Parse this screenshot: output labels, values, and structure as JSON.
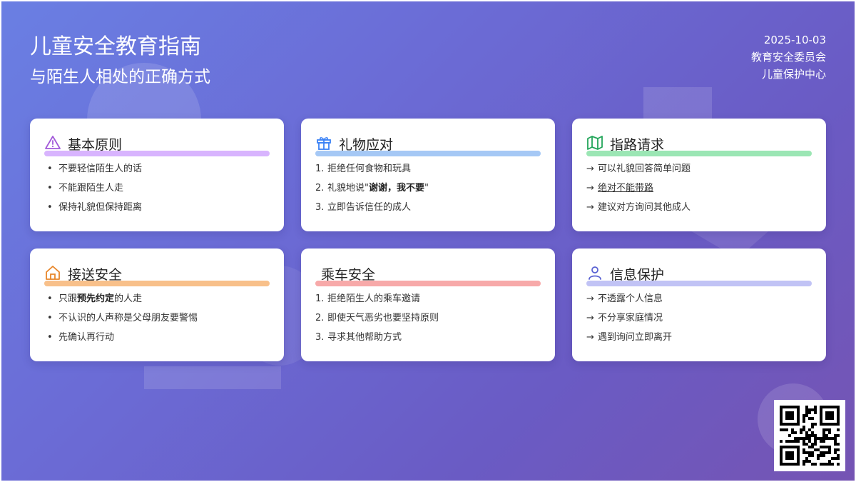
{
  "header": {
    "title": "儿童安全教育指南",
    "subtitle": "与陌生人相处的正确方式",
    "date": "2025-10-03",
    "org1": "教育安全委员会",
    "org2": "儿童保护中心"
  },
  "cards": [
    {
      "title": "基本原则",
      "icon": "warning-icon",
      "accent": "#d8b4fe",
      "items": [
        "不要轻信陌生人的话",
        "不能跟陌生人走",
        "保持礼貌但保持距离"
      ]
    },
    {
      "title": "礼物应对",
      "icon": "gift-icon",
      "accent": "#a5c8f5",
      "items": [
        "拒绝任何食物和玩具",
        "礼貌地说",
        "谢谢，我不要",
        "立即告诉信任的成人"
      ]
    },
    {
      "title": "指路请求",
      "icon": "map-icon",
      "accent": "#9be6b4",
      "items": [
        "可以礼貌回答简单问题",
        "绝对不能带路",
        "建议对方询问其他成人"
      ]
    },
    {
      "title": "接送安全",
      "icon": "home-icon",
      "accent": "#f8c08a",
      "items": [
        "只跟",
        "预先约定",
        "的人走",
        "不认识的人声称是父母朋友要警惕",
        "先确认再行动"
      ]
    },
    {
      "title": "乘车安全",
      "icon": "",
      "accent": "#f7a9a9",
      "items": [
        "拒绝陌生人的乘车邀请",
        "即使天气恶劣也要坚持原则",
        "寻求其他帮助方式"
      ]
    },
    {
      "title": "信息保护",
      "icon": "user-icon",
      "accent": "#c1c3f5",
      "items": [
        "不透露个人信息",
        "不分享家庭情况",
        "遇到询问立即离开"
      ]
    }
  ],
  "prefixes": {
    "arrow": "→",
    "n1": "1.",
    "n2": "2.",
    "n3": "3."
  },
  "qr_code": "qr-code"
}
